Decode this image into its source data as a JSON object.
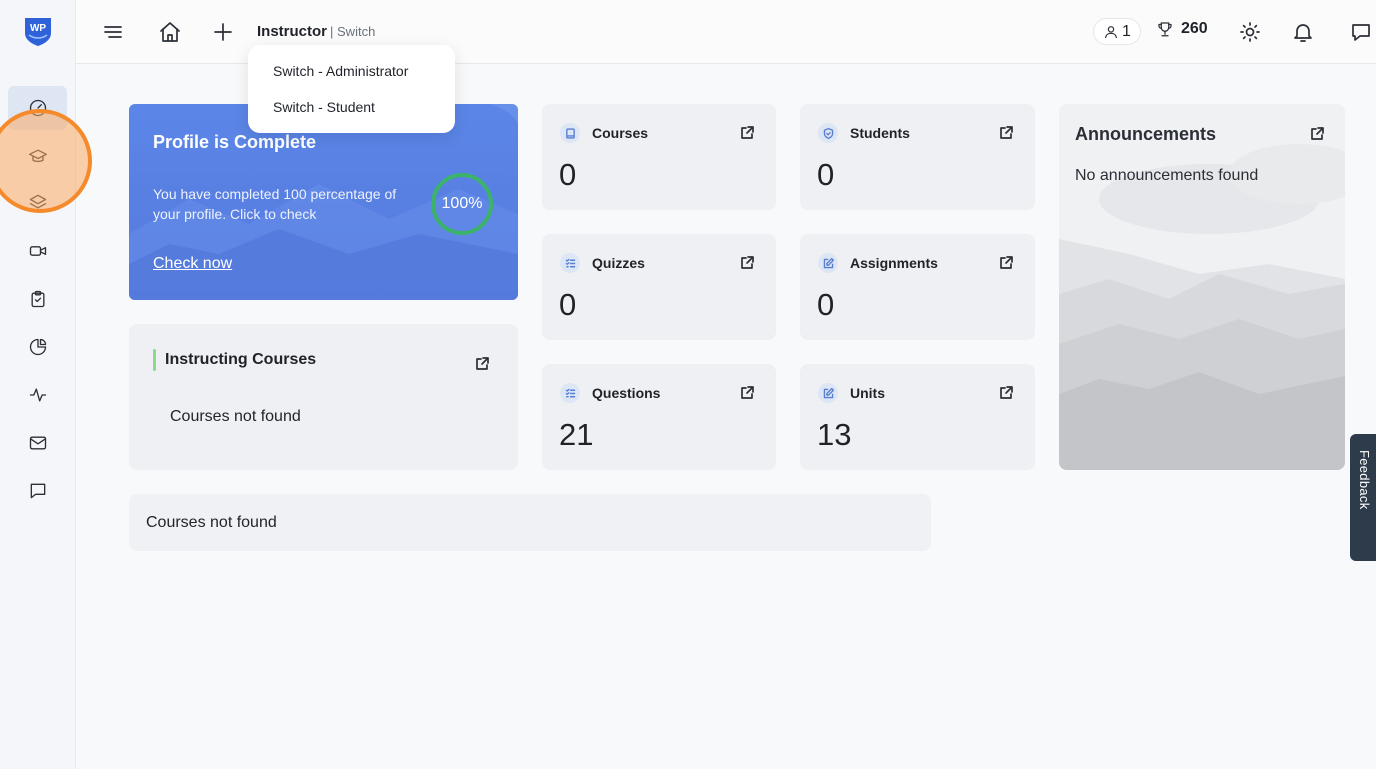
{
  "app": {
    "logo_text": "WP"
  },
  "sidebar": {
    "items": [
      {
        "icon": "dashboard-icon",
        "active": true
      },
      {
        "icon": "graduation-cap-icon"
      },
      {
        "icon": "layers-icon"
      },
      {
        "icon": "video-icon"
      },
      {
        "icon": "clipboard-check-icon"
      },
      {
        "icon": "pie-chart-icon"
      },
      {
        "icon": "activity-icon"
      },
      {
        "icon": "mail-icon"
      },
      {
        "icon": "message-icon"
      }
    ]
  },
  "topbar": {
    "role": "Instructor",
    "role_switch": "| Switch",
    "users_count": "1",
    "points": "260"
  },
  "switch_menu": {
    "items": [
      "Switch - Administrator",
      "Switch - Student"
    ]
  },
  "profile_card": {
    "title": "Profile is Complete",
    "text": "You have completed 100 percentage of your profile. Click to check",
    "link": "Check now",
    "percent_label": "100%",
    "percent": 100
  },
  "stats": [
    {
      "label": "Courses",
      "value": "0",
      "icon": "book-icon"
    },
    {
      "label": "Students",
      "value": "0",
      "icon": "shield-icon"
    },
    {
      "label": "Quizzes",
      "value": "0",
      "icon": "list-check-icon"
    },
    {
      "label": "Assignments",
      "value": "0",
      "icon": "edit-icon"
    },
    {
      "label": "Questions",
      "value": "21",
      "icon": "list-check-icon"
    },
    {
      "label": "Units",
      "value": "13",
      "icon": "edit-icon"
    }
  ],
  "announcements": {
    "title": "Announcements",
    "empty": "No announcements found"
  },
  "instructing": {
    "title": "Instructing Courses",
    "empty": "Courses not found"
  },
  "bottom_card": {
    "empty": "Courses not found"
  },
  "feedback": {
    "label": "Feedback"
  },
  "colors": {
    "accent": "#5579dc",
    "highlight": "#f58a2b",
    "ring": "#3bb36a",
    "feedback_tab": "#2d3b4b"
  }
}
